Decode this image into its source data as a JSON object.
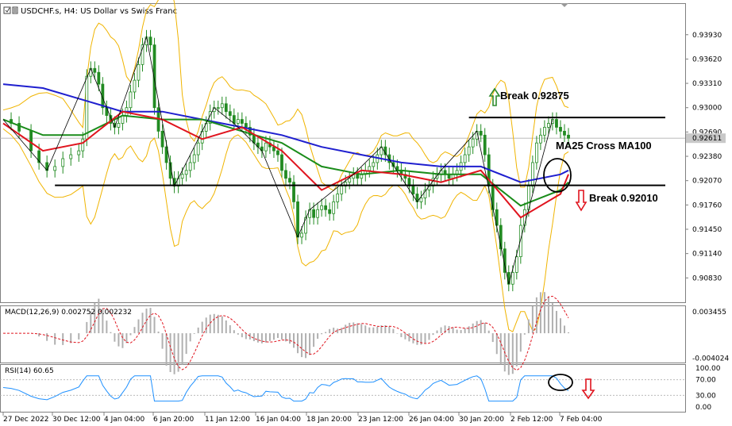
{
  "window": {
    "symbol_title": "USDCHF.s, H4:  US Dollar vs Swiss Franc"
  },
  "colors": {
    "ma_blue": "#1f1fcf",
    "ma_green": "#1a8c1a",
    "ma_red": "#e0141e",
    "bollinger": "#f0b400",
    "candle": "#228b22",
    "zigzag": "#000000",
    "macd_hist": "#b0b0b0",
    "macd_signal": "#e0141e",
    "rsi_line": "#1e90ff",
    "arrow_up": "#2e8b2e",
    "arrow_down": "#e0141e"
  },
  "chart_data": [
    {
      "type": "line",
      "title": "USDCHF.s, H4:  US Dollar vs Swiss Franc",
      "x_labels": [
        "27 Dec 2022",
        "30 Dec 12:00",
        "4 Jan 04:00",
        "6 Jan 20:00",
        "11 Jan 12:00",
        "16 Jan 04:00",
        "18 Jan 20:00",
        "23 Jan 12:00",
        "26 Jan 04:00",
        "30 Jan 20:00",
        "2 Feb 12:00",
        "7 Feb 04:00"
      ],
      "y_ticks": [
        "0.93930",
        "0.93620",
        "0.93310",
        "0.93000",
        "0.92690",
        "0.92380",
        "0.92070",
        "0.91760",
        "0.91450",
        "0.91140",
        "0.90830"
      ],
      "ylim": [
        0.9055,
        0.9415
      ],
      "current_price": "0.92611",
      "series": [
        {
          "name": "price",
          "x": [
            0,
            10,
            20,
            35,
            45,
            55,
            65,
            75,
            85,
            95,
            100,
            105,
            110,
            115,
            120,
            125,
            130,
            135,
            140,
            145,
            150,
            155,
            160,
            165,
            170,
            175,
            180,
            185,
            190,
            195,
            200,
            205,
            210,
            215,
            220,
            225,
            230,
            235,
            240,
            245,
            250,
            255,
            260,
            265,
            270,
            275,
            280,
            285,
            290,
            295,
            300,
            305,
            310,
            315,
            320,
            325,
            330,
            335,
            340,
            345,
            350,
            355,
            360,
            365,
            370,
            375,
            380,
            385,
            390,
            395,
            400,
            405,
            410,
            415,
            420,
            425,
            430,
            435,
            440,
            445,
            450,
            455,
            460,
            465,
            470,
            475,
            480,
            485,
            490,
            495,
            500,
            505,
            510,
            515,
            520,
            525,
            530,
            535,
            540,
            545,
            550,
            555,
            560,
            565,
            570,
            575,
            580,
            585,
            590,
            595,
            600,
            605,
            610,
            615,
            620,
            625,
            630,
            635,
            640,
            645,
            650,
            655,
            660,
            665,
            670,
            675,
            680,
            685,
            690,
            695,
            700,
            705,
            710
          ],
          "y": [
            0.9285,
            0.928,
            0.927,
            0.9245,
            0.923,
            0.922,
            0.9225,
            0.9235,
            0.924,
            0.9245,
            0.926,
            0.934,
            0.935,
            0.9345,
            0.933,
            0.93,
            0.929,
            0.928,
            0.9275,
            0.928,
            0.929,
            0.93,
            0.932,
            0.9335,
            0.9355,
            0.938,
            0.939,
            0.938,
            0.93,
            0.927,
            0.925,
            0.923,
            0.921,
            0.92,
            0.921,
            0.9215,
            0.922,
            0.923,
            0.924,
            0.9255,
            0.927,
            0.928,
            0.9295,
            0.93,
            0.93,
            0.9305,
            0.9295,
            0.929,
            0.928,
            0.9285,
            0.928,
            0.9275,
            0.9265,
            0.9255,
            0.925,
            0.9245,
            0.9255,
            0.925,
            0.9245,
            0.924,
            0.922,
            0.921,
            0.9205,
            0.918,
            0.9135,
            0.914,
            0.916,
            0.917,
            0.916,
            0.917,
            0.9175,
            0.917,
            0.9165,
            0.918,
            0.919,
            0.92,
            0.9205,
            0.921,
            0.9215,
            0.921,
            0.9215,
            0.922,
            0.9225,
            0.923,
            0.924,
            0.925,
            0.924,
            0.923,
            0.9225,
            0.922,
            0.9215,
            0.921,
            0.92,
            0.919,
            0.918,
            0.9185,
            0.9195,
            0.92,
            0.921,
            0.9215,
            0.922,
            0.9215,
            0.921,
            0.9215,
            0.922,
            0.923,
            0.924,
            0.925,
            0.926,
            0.927,
            0.9265,
            0.924,
            0.92,
            0.917,
            0.915,
            0.912,
            0.909,
            0.9075,
            0.909,
            0.911,
            0.915,
            0.917,
            0.92,
            0.923,
            0.9255,
            0.9265,
            0.9275,
            0.928,
            0.9285,
            0.9275,
            0.927,
            0.9265,
            0.9261
          ]
        },
        {
          "name": "ma_blue",
          "x": [
            0,
            50,
            100,
            150,
            200,
            250,
            300,
            350,
            400,
            450,
            500,
            550,
            600,
            650,
            700,
            710
          ],
          "y": [
            0.933,
            0.9325,
            0.931,
            0.9295,
            0.9295,
            0.9285,
            0.9275,
            0.9265,
            0.925,
            0.924,
            0.923,
            0.9225,
            0.9225,
            0.9205,
            0.9215,
            0.922
          ]
        },
        {
          "name": "ma_green",
          "x": [
            0,
            50,
            100,
            150,
            200,
            250,
            300,
            350,
            400,
            450,
            500,
            550,
            600,
            650,
            700,
            710
          ],
          "y": [
            0.9285,
            0.9265,
            0.9265,
            0.929,
            0.9285,
            0.9285,
            0.927,
            0.9255,
            0.9225,
            0.9215,
            0.922,
            0.9215,
            0.9215,
            0.9175,
            0.9195,
            0.9205
          ]
        },
        {
          "name": "ma_red",
          "x": [
            0,
            50,
            100,
            150,
            200,
            250,
            300,
            350,
            400,
            450,
            500,
            550,
            600,
            650,
            700,
            710
          ],
          "y": [
            0.928,
            0.9245,
            0.9255,
            0.9295,
            0.9285,
            0.926,
            0.9275,
            0.9245,
            0.9195,
            0.922,
            0.9215,
            0.9205,
            0.922,
            0.916,
            0.919,
            0.9215
          ]
        }
      ],
      "levels": [
        {
          "label": "Break 0.92875",
          "value": 0.92875
        },
        {
          "label": "Break 0.92010",
          "value": 0.9201
        }
      ],
      "annotations": [
        "MA25 Cross MA100"
      ]
    },
    {
      "type": "bar",
      "title": "MACD(12,26,9) 0.002752 0.002232",
      "y_ticks": [
        "0.003455",
        "-0.004024"
      ],
      "ylim": [
        -0.0045,
        0.004
      ]
    },
    {
      "type": "line",
      "title": "RSI(14) 60.65",
      "y_ticks": [
        "100.00",
        "70.00",
        "30.00",
        "0.00"
      ],
      "ylim": [
        0,
        100
      ],
      "levels": [
        70,
        30
      ]
    }
  ]
}
